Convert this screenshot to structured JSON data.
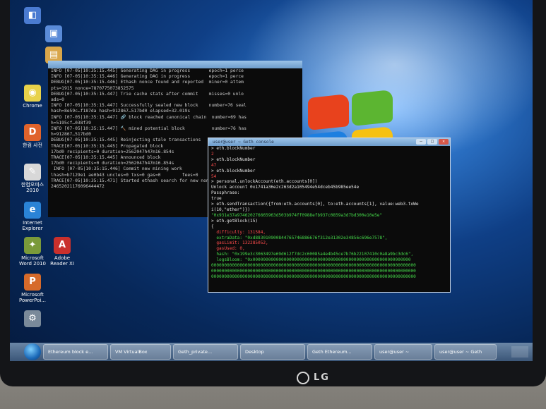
{
  "desktop_icons": [
    {
      "label": "",
      "color": "#4a7bd1",
      "glyph": "◧"
    },
    {
      "label": "",
      "color": "#5a8bd8",
      "glyph": "▣"
    },
    {
      "label": "",
      "color": "#d9a64a",
      "glyph": "▤"
    },
    {
      "label": "Chrome",
      "color": "#e8d24a",
      "glyph": "◉"
    },
    {
      "label": "한컴 사전",
      "color": "#e0632b",
      "glyph": "D"
    },
    {
      "label": "한컴오피스 2010",
      "color": "#d8d8d8",
      "glyph": "✎"
    },
    {
      "label": "Internet Explorer",
      "color": "#2a83d6",
      "glyph": "e"
    },
    {
      "label": "Microsoft Word 2010",
      "color": "#7a9a3a",
      "glyph": "✦"
    },
    {
      "label": "Adobe Reader XI",
      "color": "#c9302c",
      "glyph": "A"
    },
    {
      "label": "Microsoft PowerPoi...",
      "color": "#d66a2a",
      "glyph": "P"
    },
    {
      "label": "",
      "color": "#7a8a9a",
      "glyph": "⚙"
    }
  ],
  "back_terminal": {
    "title": "",
    "lines": [
      "INFO [07-05|10:35:15.445] Generating DAG in progress       epoch=1 perce",
      "INFO [07-05|10:35:15.446] Generating DAG in progress       epoch=1 perce",
      "DEBUG[07-05|10:35:15.446] Ethash nonce found and reported  miner=0 attem",
      "pts=1915 nonce=7870775073852575",
      "DEBUG[07-05|10:35:15.447] Trie cache stats after commit    misses=0 unlo",
      "ads=0",
      "INFO [07-05|10:35:15.447] Successfully sealed new block    number=76 seal",
      "hash=8e59c…f187da hash=912867…517bd0 elapsed=32.019s",
      "INFO [07-05|10:35:15.447] 🔗 block reached canonical chain  number=69 has",
      "h=5195cf…038f39",
      "INFO [07-05|10:35:15.447] 🔨 mined potential block          number=76 has",
      "h=912867…517bd0",
      "DEBUG[07-05|10:35:15.445] Reinjecting stale transactions",
      "TRACE[07-05|10:35:15.445] Propagated block",
      "17bd0 recipients=0 duration=2562047h47m16.854s",
      "TRACE[07-05|10:35:15.445] Announced block",
      "17bd0 recipients=0 duration=2562047h47m16.854s",
      " INFO [07-05|10:35:15.446] Commit new mining work",
      "lhash=b7129e1 ae0b43 uncles=0 txs=0 gas=0        fees=0",
      "TRACE[07-05|10:35:15.471] Started ethash search for new nonces",
      "24652021176096444472"
    ]
  },
  "front_terminal": {
    "title": "user@user ~ Geth console",
    "lines": [
      {
        "t": "> eth.blockNumber",
        "c": "w"
      },
      {
        "t": "2",
        "c": "r"
      },
      {
        "t": "> eth.blockNumber",
        "c": "w"
      },
      {
        "t": "47",
        "c": "r"
      },
      {
        "t": "> eth.blockNumber",
        "c": "w"
      },
      {
        "t": "54",
        "c": "r"
      },
      {
        "t": "> personal.unlockAccount(eth.accounts[0])",
        "c": "w"
      },
      {
        "t": "Unlock account 0x1741a36e2c263d2a105494e54dceb45b985ee54e",
        "c": "w"
      },
      {
        "t": "Passphrase:",
        "c": "w"
      },
      {
        "t": "true",
        "c": "w"
      },
      {
        "t": "> eth.sendTransaction({from:eth.accounts[0], to:eth.accounts[1], value:web3.toWe",
        "c": "w"
      },
      {
        "t": "i(10,\"ether\")})",
        "c": "w"
      },
      {
        "t": "\"0x931e37a974620276665963d503b974ff0988efb937c0859a3d7bd300e10e5e\"",
        "c": "g"
      },
      {
        "t": "> eth.getBlock(15)",
        "c": "w"
      },
      {
        "t": "{",
        "c": "w"
      },
      {
        "t": "  difficulty: 131584,",
        "c": "r"
      },
      {
        "t": "  extraData: \"0xd883010900844765746886676f312e31302e34856c696e7578\",",
        "c": "g"
      },
      {
        "t": "  gasLimit: 132285052,",
        "c": "r"
      },
      {
        "t": "  gasUsed: 0,",
        "c": "r"
      },
      {
        "t": "  hash: \"0x199e3c3063497e69d612f7dc2c60085a4e4b45ce7b76b22107410c0a8a9bc3dc6\",",
        "c": "g"
      },
      {
        "t": "  logsBloom: \"0x0000000000000000000000000000000000000000000000000000000000000",
        "c": "g"
      },
      {
        "t": "0000000000000000000000000000000000000000000000000000000000000000000000000000000",
        "c": "g"
      },
      {
        "t": "0000000000000000000000000000000000000000000000000000000000000000000000000000000",
        "c": "g"
      },
      {
        "t": "0000000000000000000000000000000000000000000000000000000000000000000000000000000",
        "c": "g"
      }
    ]
  },
  "taskbar": {
    "items": [
      "Ethereum block e...",
      "VM VirtualBox",
      "Geth_private...",
      "Desktop",
      "Geth Ethereum...",
      "user@user ~",
      "user@user ~ Geth"
    ]
  },
  "monitor_brand": "LG"
}
